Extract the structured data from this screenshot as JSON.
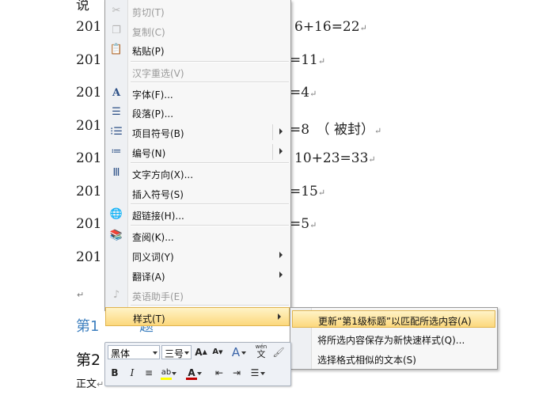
{
  "document": {
    "top_partial": "说",
    "lines": [
      {
        "left": "201",
        "right": "6+16=22"
      },
      {
        "left": "201",
        "right": "=11"
      },
      {
        "left": "201",
        "right": "=4"
      },
      {
        "left": "201",
        "right": "=8　（ 被封）"
      },
      {
        "left": "201",
        "right": "10+23=33"
      },
      {
        "left": "201",
        "right": "=15"
      },
      {
        "left": "201",
        "right": "=5"
      },
      {
        "left": "201",
        "right": ""
      }
    ],
    "para_mark": "↵",
    "heading1_left": "第1",
    "heading1_right": "题",
    "heading2_left": "第2",
    "body_label": "正文"
  },
  "context_menu": {
    "items": [
      {
        "label": "剪切(T)",
        "icon": "scissors-icon",
        "enabled": false
      },
      {
        "label": "复制(C)",
        "icon": "copy-icon",
        "enabled": false
      },
      {
        "label": "粘贴(P)",
        "icon": "paste-icon",
        "enabled": true
      },
      {
        "label": "汉字重选(V)",
        "icon": "",
        "enabled": false
      },
      {
        "label": "字体(F)...",
        "icon": "font-icon",
        "enabled": true
      },
      {
        "label": "段落(P)...",
        "icon": "paragraph-icon",
        "enabled": true
      },
      {
        "label": "项目符号(B)",
        "icon": "bullets-icon",
        "enabled": true
      },
      {
        "label": "编号(N)",
        "icon": "numbering-icon",
        "enabled": true
      },
      {
        "label": "文字方向(X)...",
        "icon": "text-direction-icon",
        "enabled": true
      },
      {
        "label": "插入符号(S)",
        "icon": "",
        "enabled": true
      },
      {
        "label": "超链接(H)...",
        "icon": "hyperlink-icon",
        "enabled": true
      },
      {
        "label": "查阅(K)...",
        "icon": "research-icon",
        "enabled": true
      },
      {
        "label": "同义词(Y)",
        "icon": "",
        "enabled": true
      },
      {
        "label": "翻译(A)",
        "icon": "",
        "enabled": true
      },
      {
        "label": "英语助手(E)",
        "icon": "english-assistant-icon",
        "enabled": false
      },
      {
        "label": "样式(T)",
        "icon": "",
        "enabled": true
      }
    ]
  },
  "styles_submenu": {
    "items": [
      {
        "label": "更新“第1级标题”以匹配所选内容(A)"
      },
      {
        "label": "将所选内容保存为新快速样式(Q)..."
      },
      {
        "label": "选择格式相似的文本(S)"
      }
    ]
  },
  "mini_toolbar": {
    "font_name": "黑体",
    "font_size": "三号",
    "grow_font": "A",
    "shrink_font": "A",
    "styles_glyph": "A",
    "phonetic_glyph": "wén",
    "phonetic_char": "文",
    "bold": "B",
    "italic": "I",
    "highlight_glyph": "ab",
    "font_color_glyph": "A",
    "colors": {
      "highlight": "#ffff00",
      "font_color": "#c00000",
      "accent": "#3d7fbf"
    }
  }
}
